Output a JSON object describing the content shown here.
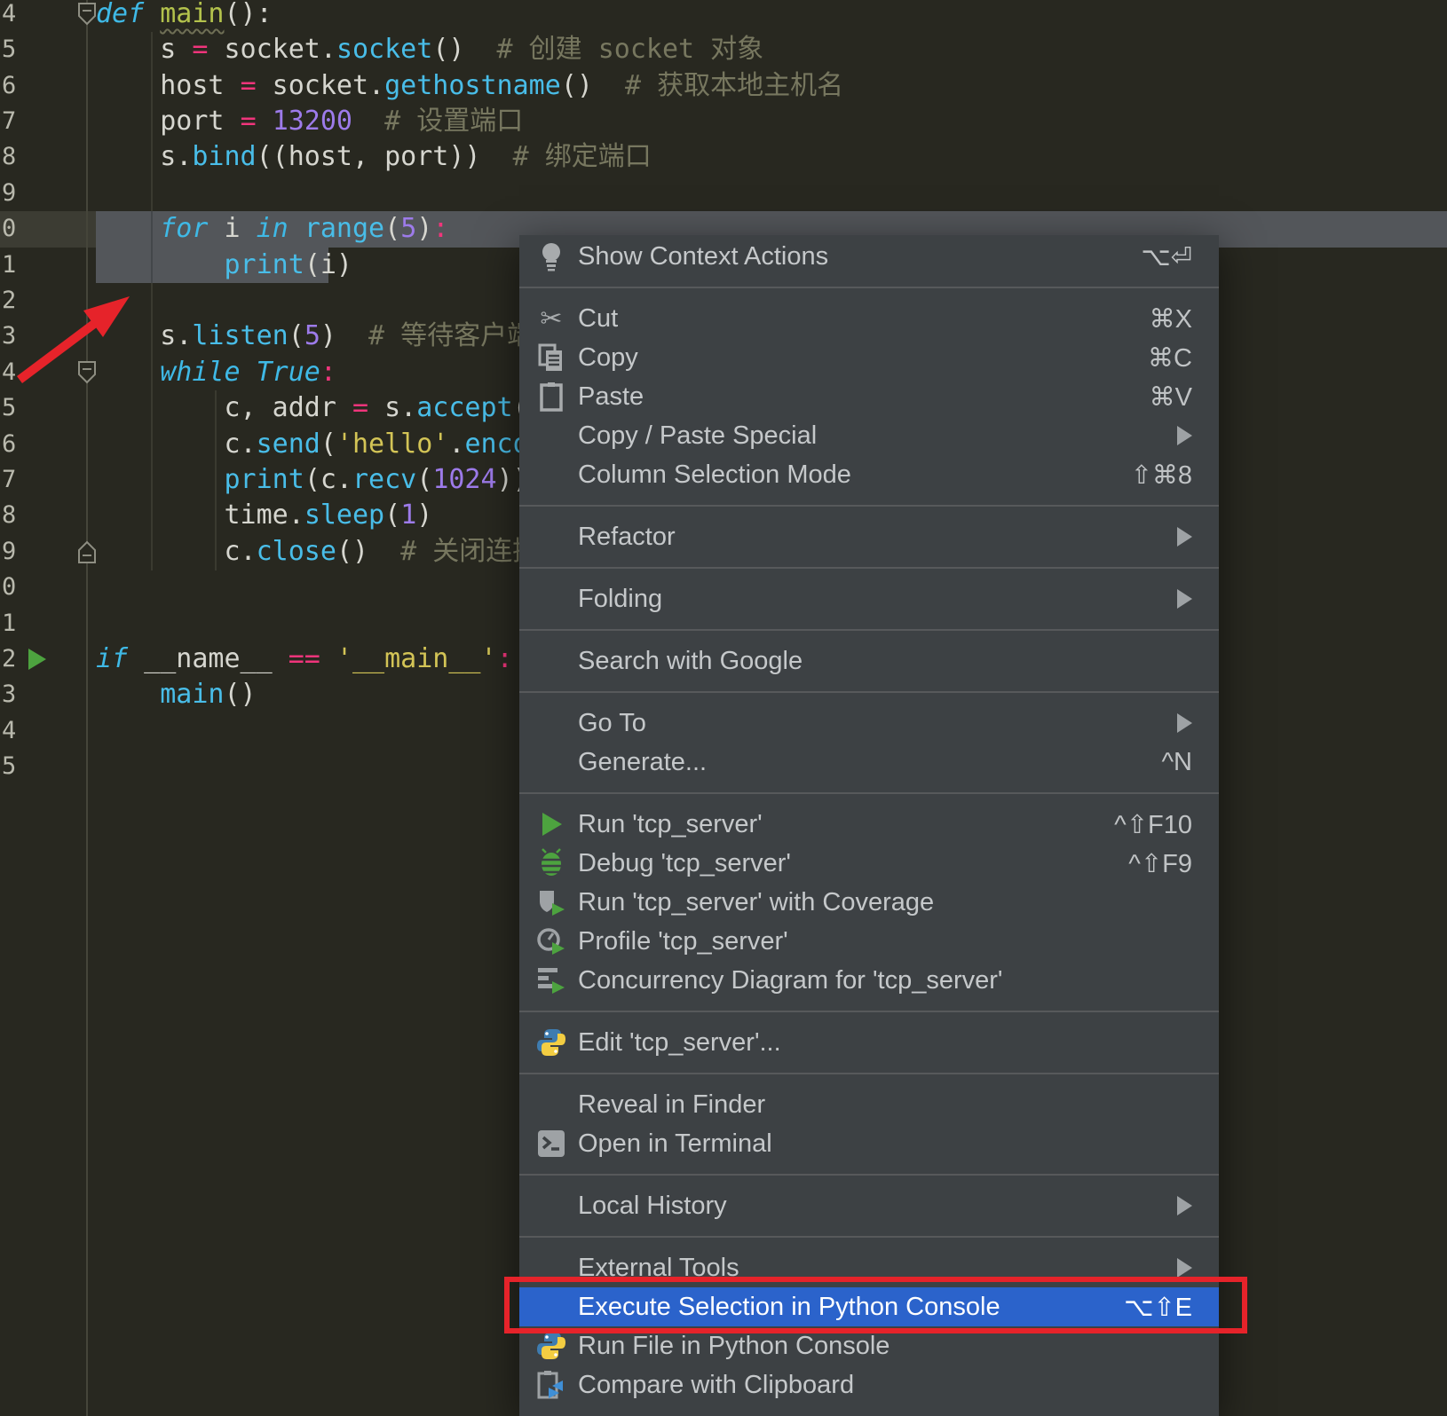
{
  "editor": {
    "lines": [
      {
        "num": "4",
        "tokens": [
          [
            "k",
            "def"
          ],
          [
            "p",
            " "
          ],
          [
            "dw",
            "main"
          ],
          [
            "p",
            "():"
          ]
        ]
      },
      {
        "num": "5",
        "tokens": [
          [
            "p",
            "    s "
          ],
          [
            "o",
            "="
          ],
          [
            "p",
            " socket."
          ],
          [
            "f",
            "socket"
          ],
          [
            "p",
            "()"
          ],
          [
            "c",
            "  # 创建 socket 对象"
          ]
        ]
      },
      {
        "num": "6",
        "tokens": [
          [
            "p",
            "    host "
          ],
          [
            "o",
            "="
          ],
          [
            "p",
            " socket."
          ],
          [
            "f",
            "gethostname"
          ],
          [
            "p",
            "()"
          ],
          [
            "c",
            "  # 获取本地主机名"
          ]
        ]
      },
      {
        "num": "7",
        "tokens": [
          [
            "p",
            "    port "
          ],
          [
            "o",
            "="
          ],
          [
            "p",
            " "
          ],
          [
            "n",
            "13200"
          ],
          [
            "c",
            "  # 设置端口"
          ]
        ]
      },
      {
        "num": "8",
        "tokens": [
          [
            "p",
            "    s."
          ],
          [
            "f",
            "bind"
          ],
          [
            "p",
            "((host, port))"
          ],
          [
            "c",
            "  # 绑定端口"
          ]
        ]
      },
      {
        "num": "9",
        "tokens": []
      },
      {
        "num": "0",
        "tokens": [
          [
            "p",
            "    "
          ],
          [
            "k",
            "for"
          ],
          [
            "p",
            " i "
          ],
          [
            "k",
            "in"
          ],
          [
            "p",
            " "
          ],
          [
            "f",
            "range"
          ],
          [
            "p",
            "("
          ],
          [
            "n",
            "5"
          ],
          [
            "p",
            ")"
          ],
          [
            "o",
            ":"
          ]
        ]
      },
      {
        "num": "1",
        "tokens": [
          [
            "p",
            "        "
          ],
          [
            "f",
            "print"
          ],
          [
            "p",
            "(i)"
          ]
        ]
      },
      {
        "num": "2",
        "tokens": []
      },
      {
        "num": "3",
        "tokens": [
          [
            "p",
            "    s."
          ],
          [
            "f",
            "listen"
          ],
          [
            "p",
            "("
          ],
          [
            "n",
            "5"
          ],
          [
            "p",
            ")"
          ],
          [
            "c",
            "  # 等待客户端连接"
          ]
        ]
      },
      {
        "num": "4",
        "tokens": [
          [
            "p",
            "    "
          ],
          [
            "k",
            "while"
          ],
          [
            "p",
            " "
          ],
          [
            "k",
            "True"
          ],
          [
            "o",
            ":"
          ]
        ]
      },
      {
        "num": "5",
        "tokens": [
          [
            "p",
            "        c, addr "
          ],
          [
            "o",
            "="
          ],
          [
            "p",
            " s."
          ],
          [
            "f",
            "accept"
          ],
          [
            "p",
            "()"
          ]
        ]
      },
      {
        "num": "6",
        "tokens": [
          [
            "p",
            "        c."
          ],
          [
            "f",
            "send"
          ],
          [
            "p",
            "("
          ],
          [
            "s",
            "'hello'"
          ],
          [
            "p",
            "."
          ],
          [
            "f",
            "encode"
          ],
          [
            "p",
            "())"
          ]
        ]
      },
      {
        "num": "7",
        "tokens": [
          [
            "p",
            "        "
          ],
          [
            "f",
            "print"
          ],
          [
            "p",
            "(c."
          ],
          [
            "f",
            "recv"
          ],
          [
            "p",
            "("
          ],
          [
            "n",
            "1024"
          ],
          [
            "p",
            "))"
          ]
        ]
      },
      {
        "num": "8",
        "tokens": [
          [
            "p",
            "        time."
          ],
          [
            "f",
            "sleep"
          ],
          [
            "p",
            "("
          ],
          [
            "n",
            "1"
          ],
          [
            "p",
            ")"
          ]
        ]
      },
      {
        "num": "9",
        "tokens": [
          [
            "p",
            "        c."
          ],
          [
            "f",
            "close"
          ],
          [
            "p",
            "()"
          ],
          [
            "c",
            "  # 关闭连接"
          ]
        ]
      },
      {
        "num": "0",
        "tokens": []
      },
      {
        "num": "1",
        "tokens": []
      },
      {
        "num": "2",
        "tokens": [
          [
            "k",
            "if"
          ],
          [
            "p",
            " __name__ "
          ],
          [
            "o",
            "=="
          ],
          [
            "p",
            " "
          ],
          [
            "s",
            "'__main__'"
          ],
          [
            "o",
            ":"
          ]
        ]
      },
      {
        "num": "3",
        "tokens": [
          [
            "p",
            "    "
          ],
          [
            "f",
            "main"
          ],
          [
            "p",
            "()"
          ]
        ]
      },
      {
        "num": "4",
        "tokens": []
      },
      {
        "num": "5",
        "tokens": []
      }
    ],
    "markers": [
      {
        "row": 0,
        "type": "fold"
      },
      {
        "row": 10,
        "type": "fold"
      },
      {
        "row": 15,
        "type": "fold-end"
      },
      {
        "row": 18,
        "type": "run"
      }
    ]
  },
  "menu": {
    "sections": [
      {
        "items": [
          {
            "id": "show-context-actions",
            "icon": "bulb",
            "label": "Show Context Actions",
            "shortcut": "⌥⏎"
          }
        ]
      },
      {
        "items": [
          {
            "id": "cut",
            "icon": "scissors",
            "label": "Cut",
            "shortcut": "⌘X"
          },
          {
            "id": "copy",
            "icon": "copy",
            "label": "Copy",
            "shortcut": "⌘C"
          },
          {
            "id": "paste",
            "icon": "paste",
            "label": "Paste",
            "shortcut": "⌘V"
          },
          {
            "id": "copy-paste-special",
            "label": "Copy / Paste Special",
            "submenu": true
          },
          {
            "id": "column-selection-mode",
            "label": "Column Selection Mode",
            "shortcut": "⇧⌘8"
          }
        ]
      },
      {
        "items": [
          {
            "id": "refactor",
            "label": "Refactor",
            "submenu": true
          }
        ]
      },
      {
        "items": [
          {
            "id": "folding",
            "label": "Folding",
            "submenu": true
          }
        ]
      },
      {
        "items": [
          {
            "id": "search-with-google",
            "label": "Search with Google"
          }
        ]
      },
      {
        "items": [
          {
            "id": "go-to",
            "label": "Go To",
            "submenu": true
          },
          {
            "id": "generate",
            "label": "Generate...",
            "shortcut": "^N"
          }
        ]
      },
      {
        "items": [
          {
            "id": "run-tcp-server",
            "icon": "run",
            "label": "Run 'tcp_server'",
            "shortcut": "^⇧F10"
          },
          {
            "id": "debug-tcp-server",
            "icon": "debug",
            "label": "Debug 'tcp_server'",
            "shortcut": "^⇧F9"
          },
          {
            "id": "run-tcp-server-with-coverage",
            "icon": "coverage",
            "label": "Run 'tcp_server' with Coverage"
          },
          {
            "id": "profile-tcp-server",
            "icon": "profile",
            "label": "Profile 'tcp_server'"
          },
          {
            "id": "concurrency-diagram",
            "icon": "concurrency",
            "label": "Concurrency Diagram for 'tcp_server'"
          }
        ]
      },
      {
        "items": [
          {
            "id": "edit-tcp-server",
            "icon": "python",
            "label": "Edit 'tcp_server'..."
          }
        ]
      },
      {
        "items": [
          {
            "id": "reveal-in-finder",
            "label": "Reveal in Finder"
          },
          {
            "id": "open-in-terminal",
            "icon": "terminal",
            "label": "Open in Terminal"
          }
        ]
      },
      {
        "items": [
          {
            "id": "local-history",
            "label": "Local History",
            "submenu": true
          }
        ]
      },
      {
        "items": [
          {
            "id": "external-tools",
            "label": "External Tools",
            "submenu": true
          },
          {
            "id": "execute-selection-in-python-console",
            "label": "Execute Selection in Python Console",
            "shortcut": "⌥⇧E",
            "selected": true,
            "redbox": true
          },
          {
            "id": "run-file-in-python-console",
            "icon": "python",
            "label": "Run File in Python Console"
          },
          {
            "id": "compare-with-clipboard",
            "icon": "compare",
            "label": "Compare with Clipboard"
          }
        ]
      }
    ]
  },
  "colors": {
    "editor_bg": "#282820",
    "selection": "#53565a",
    "current_line": "#3c3c33",
    "menu_bg": "#3d4144",
    "menu_highlight": "#2b63cb",
    "annotation_red": "#e6232a",
    "run_green": "#4da33f",
    "keyword_cyan": "#3fb9e6",
    "string_yellow": "#d3c456",
    "number_purple": "#9d7bea",
    "operator_pink": "#f0357b",
    "comment_olive": "#77775f"
  }
}
